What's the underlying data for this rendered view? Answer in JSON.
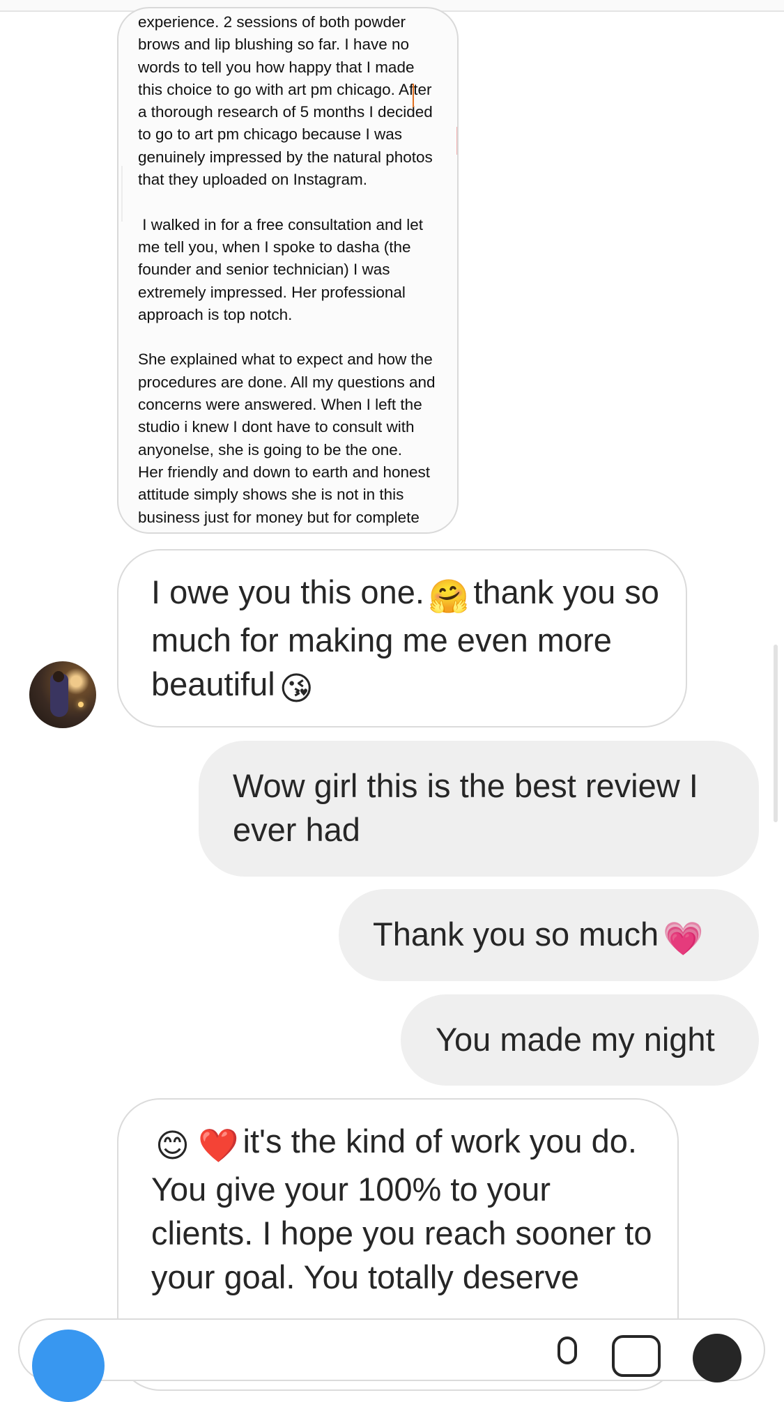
{
  "thread": {
    "review_text": "experience. 2 sessions of both powder\nbrows and lip blushing so far. I have no\nwords to tell you how happy that I made\nthis choice to go with art pm chicago. After\na thorough research of 5 months I decided\nto go to art pm chicago because I was\ngenuinely impressed by the natural photos\nthat they uploaded on Instagram.\n\n I walked in for a free consultation and let\nme tell you, when I spoke to dasha (the\nfounder and senior technician) I was\nextremely impressed. Her professional\napproach is top notch.\n\nShe explained what to expect and how the\nprocedures are done. All my questions and\nconcerns were answered. When I left the\nstudio i knew I dont have to consult with\nanyonelse, she is going to be the one.\nHer friendly and down to earth and honest\nattitude simply shows she is not in this\nbusiness just for money but for complete\nsatisfaction of her clients. And she just",
    "msg1": {
      "part1": "I owe you this one.",
      "emoji1": "🤗",
      "part2": "thank you so much for making me even more beautiful",
      "emoji2": "😘"
    },
    "msg2": "Wow girl this is the best review I ever had",
    "msg3": {
      "text": "Thank you so much",
      "emoji": "💗"
    },
    "msg4": "You made my night",
    "msg5": {
      "emoji1": "😊",
      "emoji2": "❤️",
      "text": "it's the kind of work you do. You give your 100% to your clients. I hope you reach sooner to your goal. You totally deserve"
    }
  },
  "icons": {
    "avatar": "profile-photo",
    "camera": "camera-icon",
    "mic": "microphone-icon",
    "gallery": "gallery-icon",
    "sticker": "sticker-icon"
  },
  "colors": {
    "incoming_border": "#dbdbdb",
    "outgoing_bg": "#efefef",
    "accent": "#3897f0"
  }
}
